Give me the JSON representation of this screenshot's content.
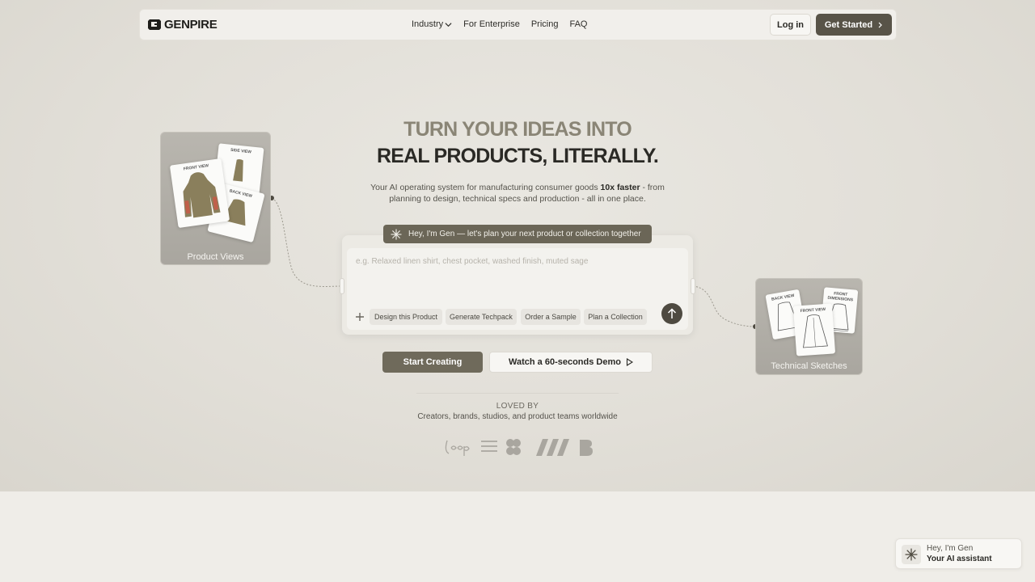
{
  "nav": {
    "logo_text": "GENPIRE",
    "links": [
      {
        "label": "Industry"
      },
      {
        "label": "For Enterprise"
      },
      {
        "label": "Pricing"
      },
      {
        "label": "FAQ"
      }
    ],
    "login_label": "Log in",
    "get_started_label": "Get Started"
  },
  "hero": {
    "headline_line1": "TURN YOUR IDEAS INTO",
    "headline_line2": "REAL PRODUCTS, LITERALLY.",
    "subtext_before": "Your AI operating system for manufacturing consumer goods ",
    "subtext_bold": "10x faster",
    "subtext_after": " - from planning to design, technical specs and production - all in one place."
  },
  "gen_banner": {
    "text": "Hey, I'm Gen — let's plan your next product or collection together"
  },
  "prompt": {
    "placeholder": "e.g. Relaxed linen shirt, chest pocket, washed finish, muted sage",
    "chips": [
      "Design this Product",
      "Generate Techpack",
      "Order a Sample",
      "Plan a Collection"
    ]
  },
  "cta": {
    "start_label": "Start Creating",
    "demo_label": "Watch a 60-seconds Demo"
  },
  "social_proof": {
    "title": "LOVED BY",
    "subtitle": "Creators, brands, studios, and product teams worldwide"
  },
  "cards": {
    "product_views": {
      "label": "Product Views",
      "sheets": [
        "FRONT VIEW",
        "SIDE VIEW",
        "BACK VIEW"
      ]
    },
    "technical_sketches": {
      "label": "Technical Sketches",
      "sheets": [
        "BACK VIEW",
        "FRONT DIMENSIONS",
        "FRONT VIEW"
      ]
    }
  },
  "assistant": {
    "line1": "Hey, I'm Gen",
    "line2": "Your AI assistant"
  },
  "colors": {
    "accent_dark": "#585348",
    "accent_olive": "#6f6a5b",
    "headline_muted": "#8a8576"
  }
}
